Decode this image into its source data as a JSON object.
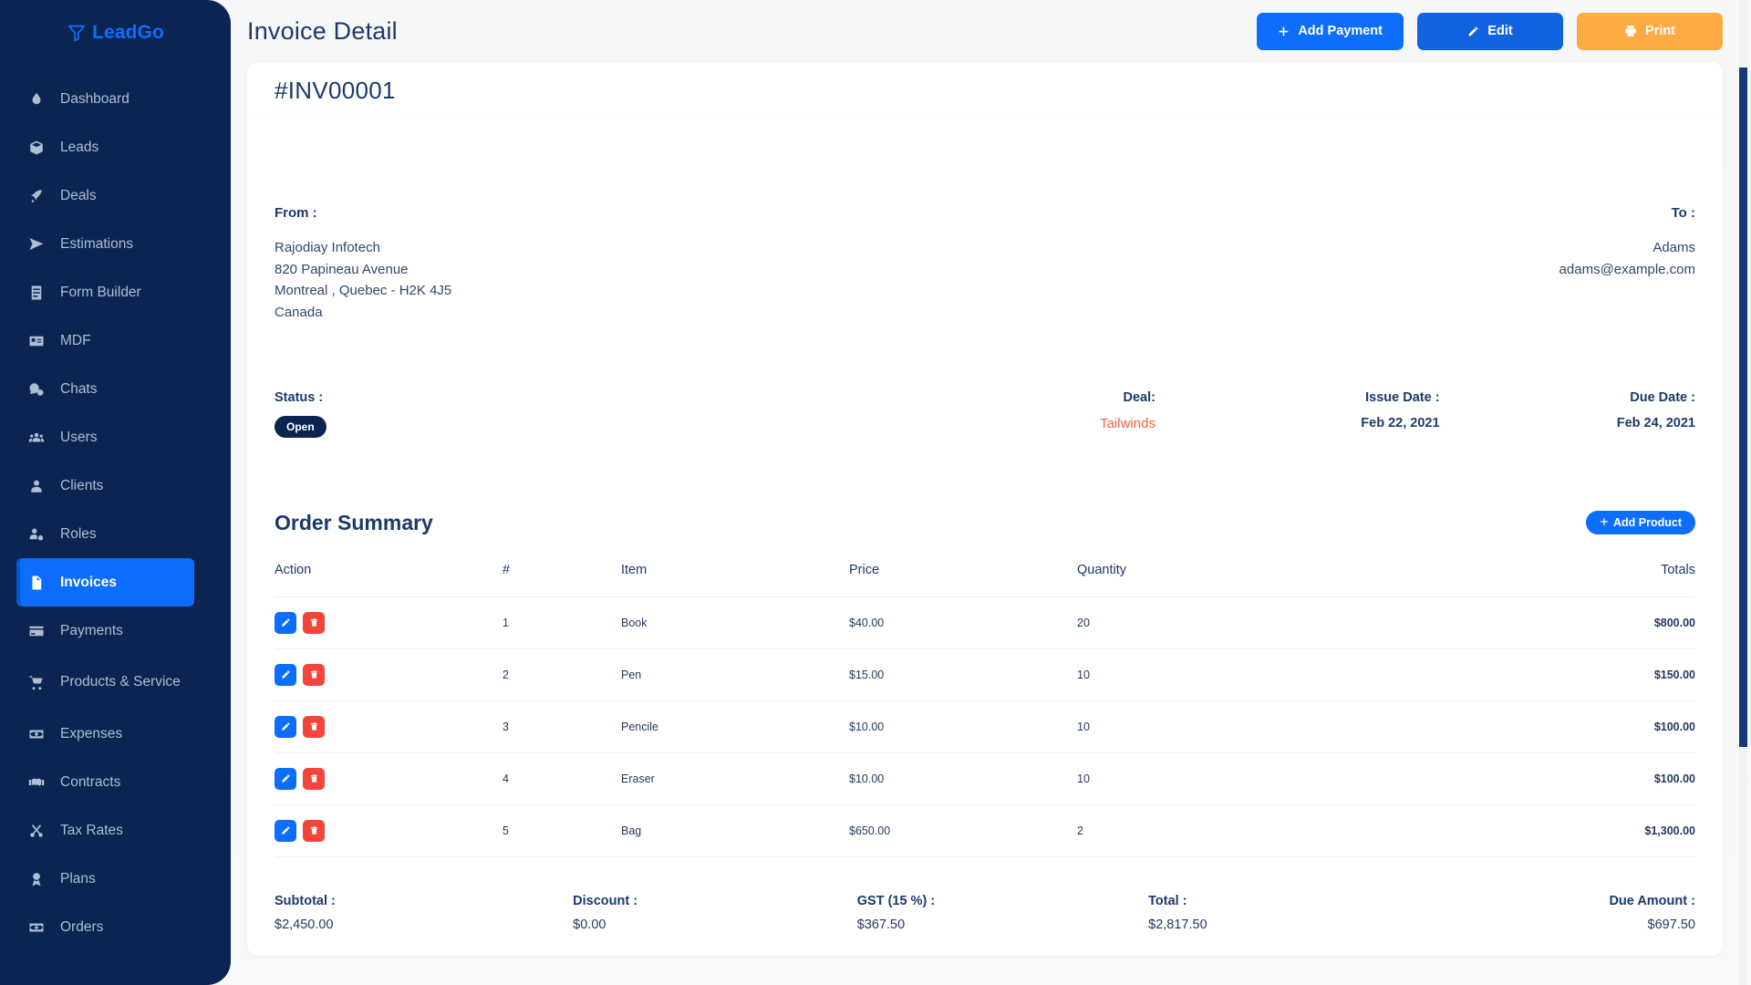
{
  "brand": {
    "name": "LeadGo",
    "icon": "funnel-icon",
    "color": "#0d6efd"
  },
  "sidebar": {
    "items": [
      {
        "label": "Dashboard",
        "icon": "droplet-icon",
        "active": false
      },
      {
        "label": "Leads",
        "icon": "box-icon",
        "active": false
      },
      {
        "label": "Deals",
        "icon": "rocket-icon",
        "active": false
      },
      {
        "label": "Estimations",
        "icon": "send-icon",
        "active": false
      },
      {
        "label": "Form Builder",
        "icon": "form-icon",
        "active": false
      },
      {
        "label": "MDF",
        "icon": "card-icon",
        "active": false
      },
      {
        "label": "Chats",
        "icon": "chat-icon",
        "active": false
      },
      {
        "label": "Users",
        "icon": "users-icon",
        "active": false
      },
      {
        "label": "Clients",
        "icon": "user-icon",
        "active": false
      },
      {
        "label": "Roles",
        "icon": "user-gear-icon",
        "active": false
      },
      {
        "label": "Invoices",
        "icon": "invoice-icon",
        "active": true
      },
      {
        "label": "Payments",
        "icon": "payment-icon",
        "active": false
      },
      {
        "label": "Products & Service",
        "icon": "cart-icon",
        "active": false
      },
      {
        "label": "Expenses",
        "icon": "money-icon",
        "active": false
      },
      {
        "label": "Contracts",
        "icon": "handshake-icon",
        "active": false
      },
      {
        "label": "Tax Rates",
        "icon": "scissors-icon",
        "active": false
      },
      {
        "label": "Plans",
        "icon": "medal-icon",
        "active": false
      },
      {
        "label": "Orders",
        "icon": "money-icon",
        "active": false
      }
    ]
  },
  "header": {
    "title": "Invoice Detail",
    "add_payment_label": "Add Payment",
    "edit_label": "Edit",
    "print_label": "Print"
  },
  "invoice": {
    "number": "#INV00001",
    "from_label": "From :",
    "from_lines": [
      "Rajodiay Infotech",
      "820 Papineau Avenue",
      "Montreal , Quebec - H2K 4J5",
      "Canada"
    ],
    "to_label": "To :",
    "to_lines": [
      "Adams",
      "adams@example.com"
    ],
    "status_label": "Status :",
    "status_value": "Open",
    "deal_label": "Deal:",
    "deal_value": "Tailwinds",
    "issue_date_label": "Issue Date :",
    "issue_date_value": "Feb 22, 2021",
    "due_date_label": "Due Date :",
    "due_date_value": "Feb 24, 2021"
  },
  "order_summary": {
    "title": "Order Summary",
    "add_product_label": "Add Product",
    "columns": [
      "Action",
      "#",
      "Item",
      "Price",
      "Quantity",
      "Totals"
    ],
    "rows": [
      {
        "num": "1",
        "item": "Book",
        "price": "$40.00",
        "qty": "20",
        "total": "$800.00"
      },
      {
        "num": "2",
        "item": "Pen",
        "price": "$15.00",
        "qty": "10",
        "total": "$150.00"
      },
      {
        "num": "3",
        "item": "Pencile",
        "price": "$10.00",
        "qty": "10",
        "total": "$100.00"
      },
      {
        "num": "4",
        "item": "Eraser",
        "price": "$10.00",
        "qty": "10",
        "total": "$100.00"
      },
      {
        "num": "5",
        "item": "Bag",
        "price": "$650.00",
        "qty": "2",
        "total": "$1,300.00"
      }
    ]
  },
  "totals": {
    "subtotal_label": "Subtotal :",
    "subtotal_value": "$2,450.00",
    "discount_label": "Discount :",
    "discount_value": "$0.00",
    "gst_label": "GST (15 %) :",
    "gst_value": "$367.50",
    "total_label": "Total :",
    "total_value": "$2,817.50",
    "due_label": "Due Amount :",
    "due_value": "$697.50"
  },
  "colors": {
    "sidebar_bg": "#0b2452",
    "accent_blue": "#0d6efd",
    "warning_orange": "#fcaa42",
    "danger_red": "#f4453c",
    "link_orange": "#f2643f",
    "text_navy": "#1b3a6b"
  }
}
